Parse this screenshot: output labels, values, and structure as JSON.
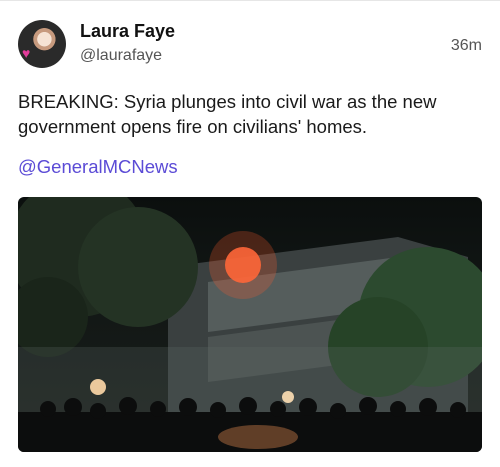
{
  "tweet": {
    "author_name": "Laura Faye",
    "author_handle": "@laurafaye",
    "timestamp": "36m",
    "text": "BREAKING: Syria plunges into civil war as the new government opens fire on civilians' homes.",
    "mention": "@GeneralMCNews",
    "avatar_icon": "profile-photo",
    "media_icon": "video-still"
  },
  "colors": {
    "link": "#5b4bd6",
    "handle": "#555555"
  }
}
